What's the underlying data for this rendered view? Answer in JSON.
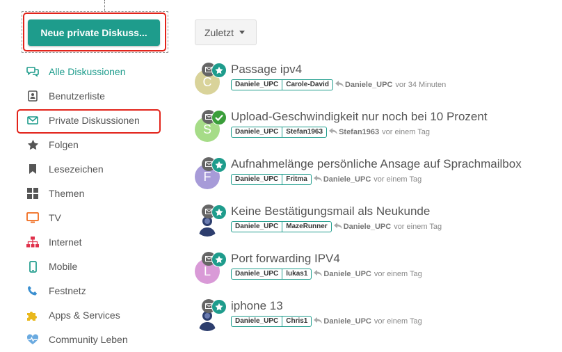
{
  "new_button": {
    "label": "Neue private Diskuss..."
  },
  "nav": [
    {
      "label": "Alle Diskussionen",
      "icon": "chat-bubbles-icon",
      "active": true
    },
    {
      "label": "Benutzerliste",
      "icon": "contact-card-icon"
    },
    {
      "label": "Private Diskussionen",
      "icon": "envelope-icon"
    },
    {
      "label": "Folgen",
      "icon": "star-icon"
    },
    {
      "label": "Lesezeichen",
      "icon": "bookmark-icon"
    },
    {
      "label": "Themen",
      "icon": "grid-icon"
    },
    {
      "label": "TV",
      "icon": "tv-icon"
    },
    {
      "label": "Internet",
      "icon": "network-icon"
    },
    {
      "label": "Mobile",
      "icon": "mobile-icon"
    },
    {
      "label": "Festnetz",
      "icon": "phone-icon"
    },
    {
      "label": "Apps & Services",
      "icon": "puzzle-icon"
    },
    {
      "label": "Community Leben",
      "icon": "heartbeat-icon"
    }
  ],
  "sort": {
    "label": "Zuletzt"
  },
  "discussions": [
    {
      "title": "Passage ipv4",
      "avatar_letter": "C",
      "avatar_color": "#d9d39a",
      "status": "star",
      "tags": [
        "Daniele_UPC",
        "Carole-David"
      ],
      "last_user": "Daniele_UPC",
      "time": "vor 34 Minuten"
    },
    {
      "title": "Upload-Geschwindigkeit nur noch bei 10 Prozent",
      "avatar_letter": "S",
      "avatar_color": "#a6dc88",
      "status": "check",
      "tags": [
        "Daniele_UPC",
        "Stefan1963"
      ],
      "last_user": "Stefan1963",
      "time": "vor einem Tag"
    },
    {
      "title": "Aufnahmelänge persönliche Ansage auf Sprachmailbox",
      "avatar_letter": "F",
      "avatar_color": "#a79bd8",
      "status": "star",
      "tags": [
        "Daniele_UPC",
        "Fritma"
      ],
      "last_user": "Daniele_UPC",
      "time": "vor einem Tag"
    },
    {
      "title": "Keine Bestätigungsmail als Neukunde",
      "avatar_letter": "",
      "avatar_color": "#ffffff",
      "status": "star",
      "tags": [
        "Daniele_UPC",
        "MazeRunner"
      ],
      "last_user": "Daniele_UPC",
      "time": "vor einem Tag"
    },
    {
      "title": "Port forwarding IPV4",
      "avatar_letter": "L",
      "avatar_color": "#d99ad7",
      "status": "star",
      "tags": [
        "Daniele_UPC",
        "lukas1"
      ],
      "last_user": "Daniele_UPC",
      "time": "vor einem Tag"
    },
    {
      "title": "iphone 13",
      "avatar_letter": "",
      "avatar_color": "#ffffff",
      "status": "star",
      "tags": [
        "Daniele_UPC",
        "Chris1"
      ],
      "last_user": "Daniele_UPC",
      "time": "vor einem Tag"
    }
  ],
  "colors": {
    "accent": "#1e9c8c",
    "highlight": "#e2231a"
  }
}
